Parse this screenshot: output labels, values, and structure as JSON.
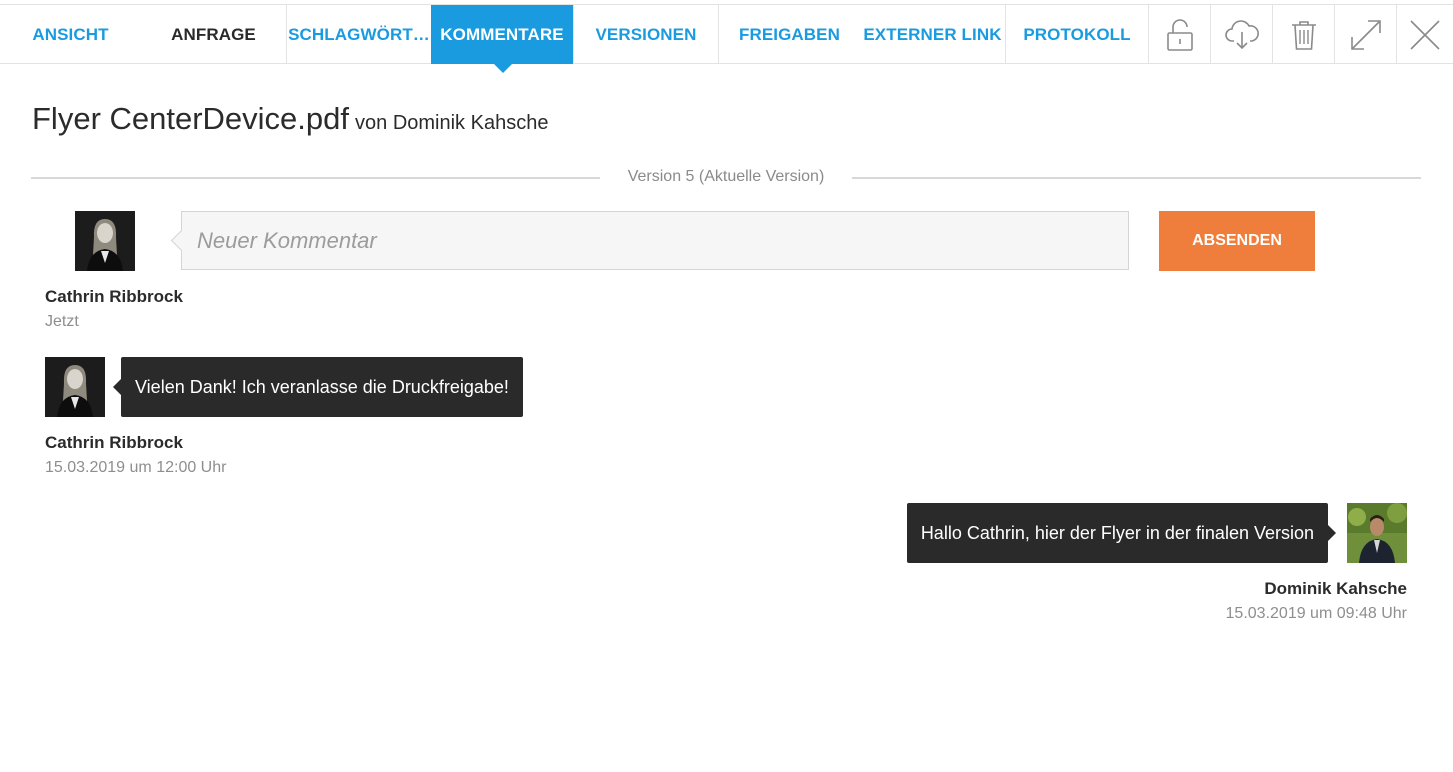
{
  "tabs": [
    {
      "label": "ANSICHT"
    },
    {
      "label": "ANFRAGE"
    },
    {
      "label": "SCHLAGWÖRT…"
    },
    {
      "label": "KOMMENTARE"
    },
    {
      "label": "VERSIONEN"
    },
    {
      "label": "FREIGABEN"
    },
    {
      "label": "EXTERNER LINK"
    },
    {
      "label": "PROTOKOLL"
    }
  ],
  "active_tab": "KOMMENTARE",
  "toolbar_icons": [
    "unlock-icon",
    "cloud-download-icon",
    "trash-icon",
    "expand-icon",
    "close-icon"
  ],
  "document": {
    "filename": "Flyer CenterDevice.pdf",
    "author_prefix": "von Dominik Kahsche"
  },
  "version_label": "Version 5 (Aktuelle Version)",
  "new_comment": {
    "placeholder": "Neuer Kommentar",
    "value": "",
    "submit_label": "ABSENDEN",
    "user_name": "Cathrin Ribbrock",
    "time": "Jetzt"
  },
  "comments": [
    {
      "text": "Vielen Dank! Ich veranlasse die Druckfreigabe!",
      "user_name": "Cathrin Ribbrock",
      "time": "15.03.2019 um 12:00 Uhr",
      "side": "left"
    },
    {
      "text": "Hallo Cathrin, hier der Flyer in der finalen Version",
      "user_name": "Dominik Kahsche",
      "time": "15.03.2019 um 09:48 Uhr",
      "side": "right"
    }
  ],
  "colors": {
    "accent_blue": "#1a9be0",
    "submit_orange": "#ef7d3c",
    "bubble_dark": "#2a2a2a"
  }
}
